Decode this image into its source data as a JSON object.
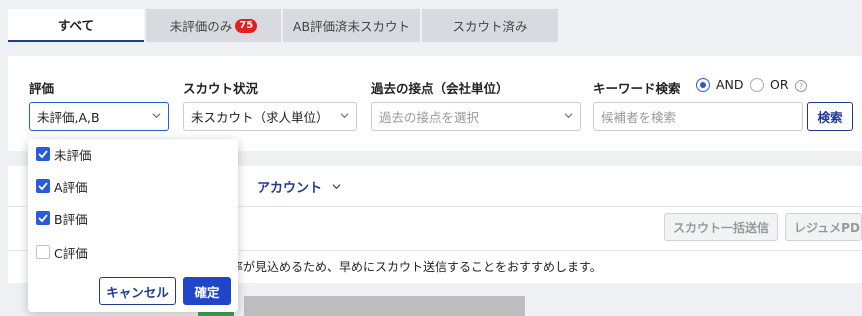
{
  "tabs": [
    {
      "label": "すべて",
      "active": true
    },
    {
      "label": "未評価のみ",
      "badge": "75"
    },
    {
      "label": "AB評価済未スカウト"
    },
    {
      "label": "スカウト済み"
    }
  ],
  "filters": {
    "evaluation": {
      "label": "評価",
      "value": "未評価,A,B"
    },
    "scout_status": {
      "label": "スカウト状況",
      "value": "未スカウト（求人単位）"
    },
    "past_contact": {
      "label": "過去の接点（会社単位）",
      "placeholder": "過去の接点を選択"
    },
    "keyword": {
      "label": "キーワード検索",
      "mode_options": [
        "AND",
        "OR"
      ],
      "selected_mode": "AND",
      "help_icon": "?",
      "placeholder": "候補者を検索",
      "search_label": "検索"
    }
  },
  "results": {
    "account_label": "：",
    "account_value": "アカウント",
    "bulk_scout_label": "スカウト一括送信",
    "resume_pdf_label": "レジュメPDF",
    "note": "率が見込めるため、早めにスカウト送信することをおすすめします。"
  },
  "dropdown": {
    "options": [
      {
        "label": "未評価",
        "checked": true
      },
      {
        "label": "A評価",
        "checked": true
      },
      {
        "label": "B評価",
        "checked": true
      },
      {
        "label": "C評価",
        "checked": false
      }
    ],
    "cancel_label": "キャンセル",
    "confirm_label": "確定"
  },
  "colors": {
    "accent": "#1f3a93",
    "checkbox": "#2a5bd7",
    "badge": "#e02020"
  }
}
